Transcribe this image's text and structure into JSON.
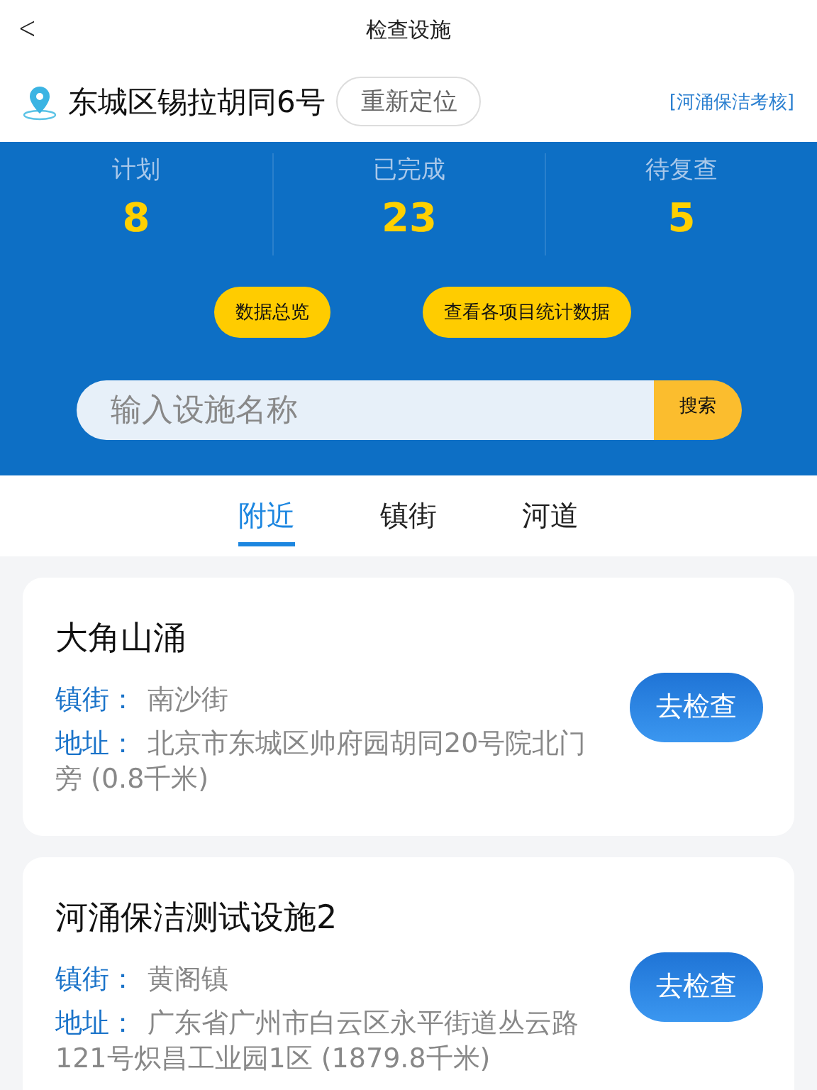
{
  "nav": {
    "back_icon": "<",
    "title": "检查设施"
  },
  "location": {
    "address": "东城区锡拉胡同6号",
    "relocate_button": "重新定位",
    "link": "[河涌保洁考核]"
  },
  "stats": [
    {
      "label": "计划",
      "value": "8"
    },
    {
      "label": "已完成",
      "value": "23"
    },
    {
      "label": "待复查",
      "value": "5"
    }
  ],
  "action_buttons": [
    "数据总览",
    "查看各项目统计数据"
  ],
  "search": {
    "placeholder": "输入设施名称",
    "button": "搜索"
  },
  "tabs": [
    {
      "label": "附近",
      "selected": true
    },
    {
      "label": "镇街",
      "selected": false
    },
    {
      "label": "河道",
      "selected": false
    }
  ],
  "facilities": [
    {
      "name": "大角山涌",
      "town_label": "镇街：",
      "town": "南沙街",
      "address_label": "地址：",
      "address": "北京市东城区帅府园胡同20号院北门旁 (0.8千米)",
      "button": "去检查"
    },
    {
      "name": "河涌保洁测试设施2",
      "town_label": "镇街：",
      "town": "黄阁镇",
      "address_label": "地址：",
      "address": "广东省广州市白云区永平街道丛云路121号炽昌工业园1区 (1879.8千米)",
      "button": "去检查"
    }
  ]
}
